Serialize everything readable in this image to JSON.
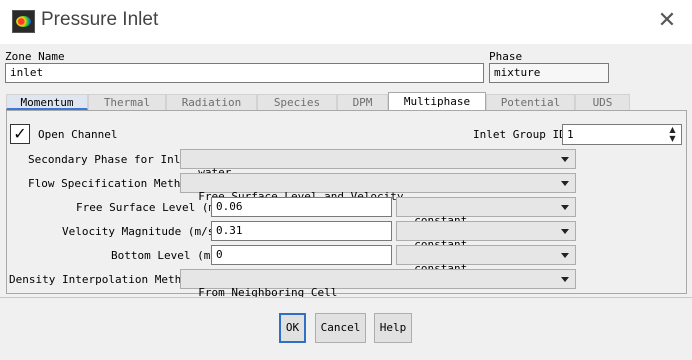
{
  "window": {
    "title": "Pressure Inlet",
    "close_glyph": "✕",
    "app_icon": "fluent-app-icon"
  },
  "zone": {
    "label": "Zone Name",
    "value": "inlet"
  },
  "phase": {
    "label": "Phase",
    "value": "mixture"
  },
  "tabs": [
    {
      "label": "Momentum"
    },
    {
      "label": "Thermal"
    },
    {
      "label": "Radiation"
    },
    {
      "label": "Species"
    },
    {
      "label": "DPM"
    },
    {
      "label": "Multiphase"
    },
    {
      "label": "Potential"
    },
    {
      "label": "UDS"
    }
  ],
  "active_tab": "Multiphase",
  "multiphase": {
    "open_channel": {
      "label": "Open Channel",
      "checked": true,
      "check_glyph": "✓"
    },
    "inlet_group": {
      "label": "Inlet Group ID",
      "value": "1",
      "up_glyph": "▲",
      "down_glyph": "▼"
    },
    "secondary_phase": {
      "label": "Secondary Phase for Inlet",
      "value": "water"
    },
    "flow_spec": {
      "label": "Flow Specification Method",
      "value": "Free Surface Level and Velocity"
    },
    "free_surface": {
      "label": "Free Surface Level (m)",
      "value": "0.06",
      "method": "constant"
    },
    "velocity": {
      "label": "Velocity Magnitude (m/s)",
      "value": "0.31",
      "method": "constant"
    },
    "bottom": {
      "label": "Bottom Level (m)",
      "value": "0",
      "method": "constant"
    },
    "density": {
      "label": "Density Interpolation Method",
      "value": "From Neighboring Cell"
    }
  },
  "buttons": {
    "ok": "OK",
    "cancel": "Cancel",
    "help": "Help"
  },
  "colors": {
    "accent": "#2f6fc4",
    "tab_underline": "#3b78d8"
  }
}
